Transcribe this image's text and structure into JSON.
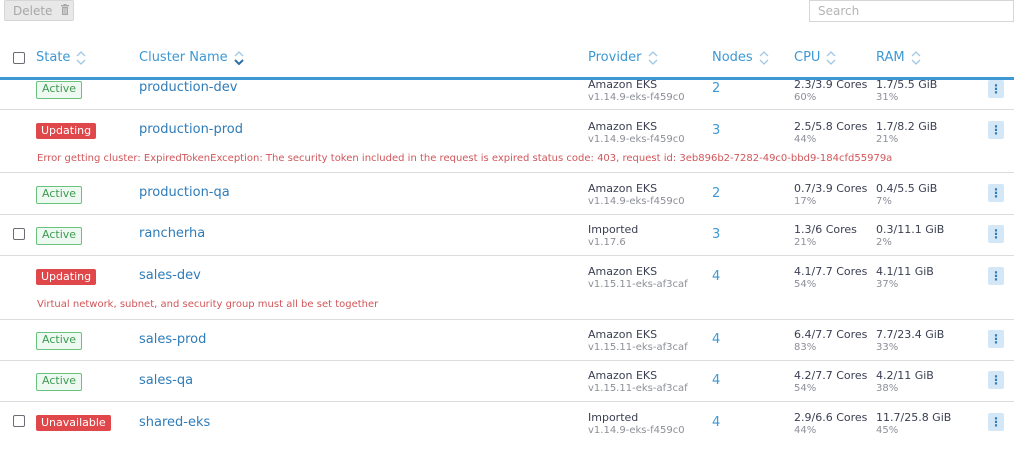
{
  "toolbar": {
    "delete_label": "Delete",
    "search_placeholder": "Search"
  },
  "columns": {
    "state": "State",
    "cluster_name": "Cluster Name",
    "provider": "Provider",
    "nodes": "Nodes",
    "cpu": "CPU",
    "ram": "RAM"
  },
  "rows": [
    {
      "state": "Active",
      "name": "production-dev",
      "provider": "Amazon EKS",
      "version": "v1.14.9-eks-f459c0",
      "nodes": "2",
      "cpu": "2.3/3.9 Cores",
      "cpu_pct": "60%",
      "ram": "1.7/5.5 GiB",
      "ram_pct": "31%"
    },
    {
      "state": "Updating",
      "name": "production-prod",
      "provider": "Amazon EKS",
      "version": "v1.14.9-eks-f459c0",
      "nodes": "3",
      "cpu": "2.5/5.8 Cores",
      "cpu_pct": "44%",
      "ram": "1.7/8.2 GiB",
      "ram_pct": "21%",
      "error": "Error getting cluster: ExpiredTokenException: The security token included in the request is expired status code: 403, request id: 3eb896b2-7282-49c0-bbd9-184cfd55979a"
    },
    {
      "state": "Active",
      "name": "production-qa",
      "provider": "Amazon EKS",
      "version": "v1.14.9-eks-f459c0",
      "nodes": "2",
      "cpu": "0.7/3.9 Cores",
      "cpu_pct": "17%",
      "ram": "0.4/5.5 GiB",
      "ram_pct": "7%"
    },
    {
      "state": "Active",
      "name": "rancherha",
      "provider": "Imported",
      "version": "v1.17.6",
      "nodes": "3",
      "cpu": "1.3/6 Cores",
      "cpu_pct": "21%",
      "ram": "0.3/11.1 GiB",
      "ram_pct": "2%"
    },
    {
      "state": "Updating",
      "name": "sales-dev",
      "provider": "Amazon EKS",
      "version": "v1.15.11-eks-af3caf",
      "nodes": "4",
      "cpu": "4.1/7.7 Cores",
      "cpu_pct": "54%",
      "ram": "4.1/11 GiB",
      "ram_pct": "37%",
      "error": "Virtual network, subnet, and security group must all be set together"
    },
    {
      "state": "Active",
      "name": "sales-prod",
      "provider": "Amazon EKS",
      "version": "v1.15.11-eks-af3caf",
      "nodes": "4",
      "cpu": "6.4/7.7 Cores",
      "cpu_pct": "83%",
      "ram": "7.7/23.4 GiB",
      "ram_pct": "33%"
    },
    {
      "state": "Active",
      "name": "sales-qa",
      "provider": "Amazon EKS",
      "version": "v1.15.11-eks-af3caf",
      "nodes": "4",
      "cpu": "4.2/7.7 Cores",
      "cpu_pct": "54%",
      "ram": "4.2/11 GiB",
      "ram_pct": "38%"
    },
    {
      "state": "Unavailable",
      "name": "shared-eks",
      "provider": "Imported",
      "version": "v1.14.9-eks-f459c0",
      "nodes": "4",
      "cpu": "2.9/6.6 Cores",
      "cpu_pct": "44%",
      "ram": "11.7/25.8 GiB",
      "ram_pct": "45%"
    }
  ],
  "colors": {
    "accent": "#3d98d3",
    "active": "#3c9a52",
    "updating": "#e0474a",
    "error_text": "#d0565a"
  },
  "icons": [
    "trash-icon",
    "sort-icon",
    "sort-down-icon",
    "kebab-icon"
  ]
}
